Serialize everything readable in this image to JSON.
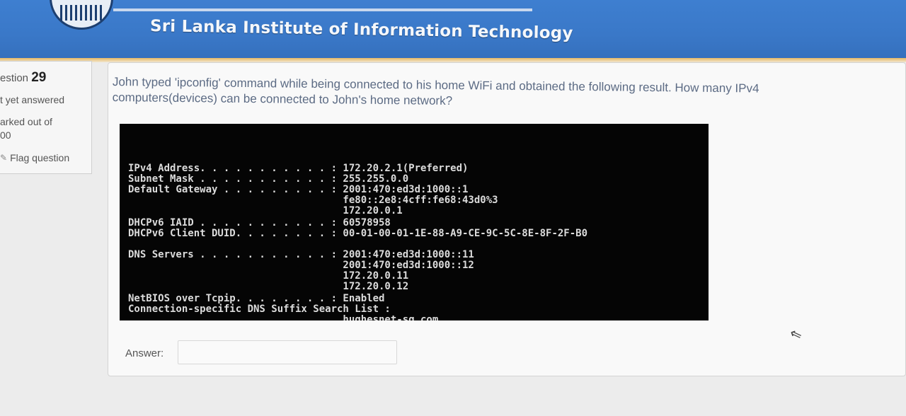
{
  "header": {
    "title": "Sri Lanka Institute of Information Technology"
  },
  "question_info": {
    "label": "estion",
    "number": "29",
    "status": "t yet answered",
    "marked_line1": "arked out of",
    "marked_line2": "00",
    "flag_label": "Flag question",
    "flag_icon": "flag-icon"
  },
  "question": {
    "text_line1": "John typed 'ipconfig' command while being connected to his home WiFi and obtained the following result. How many IPv4",
    "text_line2": "computers(devices) can be connected to John's home network?"
  },
  "terminal": {
    "lines": [
      "IPv4 Address. . . . . . . . . . . : 172.20.2.1(Preferred)",
      "Subnet Mask . . . . . . . . . . . : 255.255.0.0",
      "Default Gateway . . . . . . . . . : 2001:470:ed3d:1000::1",
      "                                    fe80::2e8:4cff:fe68:43d0%3",
      "                                    172.20.0.1",
      "DHCPv6 IAID . . . . . . . . . . . : 60578958",
      "DHCPv6 Client DUID. . . . . . . . : 00-01-00-01-1E-88-A9-CE-9C-5C-8E-8F-2F-B0",
      "DNS Servers . . . . . . . . . . . : 2001:470:ed3d:1000::11",
      "                                    2001:470:ed3d:1000::12",
      "                                    172.20.0.11",
      "                                    172.20.0.12",
      "NetBIOS over Tcpip. . . . . . . . : Enabled",
      "Connection-specific DNS Suffix Search List :",
      "                                    hughesnet-sg.com"
    ]
  },
  "answer": {
    "label": "Answer:",
    "value": ""
  },
  "colors": {
    "header_blue": "#3a78c8",
    "gold_stripe": "#e7b863",
    "terminal_bg": "#050505",
    "terminal_text": "#dcdcdc"
  }
}
